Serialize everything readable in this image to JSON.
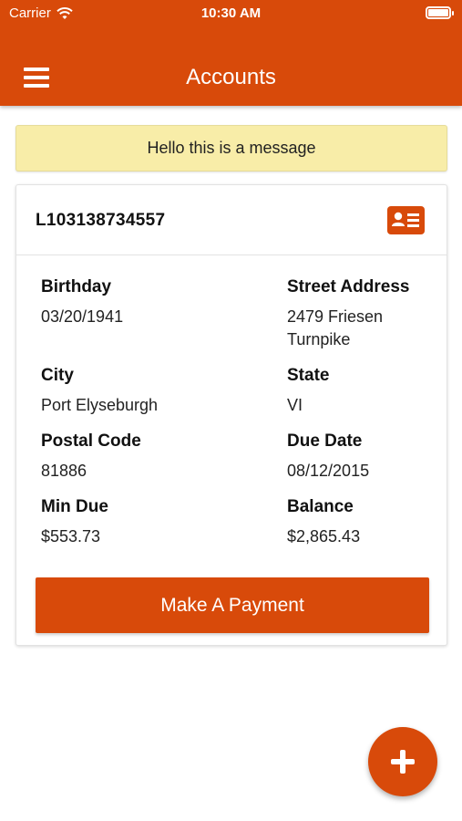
{
  "status_bar": {
    "carrier": "Carrier",
    "time": "10:30 AM"
  },
  "header": {
    "title": "Accounts",
    "menu_icon": "hamburger-menu-icon"
  },
  "banner": {
    "message": "Hello this is a message"
  },
  "account": {
    "number": "L103138734557",
    "id_card_icon": "id-card-icon",
    "fields": {
      "birthday": {
        "label": "Birthday",
        "value": "03/20/1941"
      },
      "street_address": {
        "label": "Street Address",
        "value": "2479 Friesen Turnpike"
      },
      "city": {
        "label": "City",
        "value": "Port Elyseburgh"
      },
      "state": {
        "label": "State",
        "value": "VI"
      },
      "postal_code": {
        "label": "Postal Code",
        "value": "81886"
      },
      "due_date": {
        "label": "Due Date",
        "value": "08/12/2015"
      },
      "min_due": {
        "label": "Min Due",
        "value": "$553.73"
      },
      "balance": {
        "label": "Balance",
        "value": "$2,865.43"
      }
    },
    "pay_button_label": "Make A Payment"
  },
  "fab": {
    "icon": "plus-icon"
  },
  "colors": {
    "primary": "#d84a0a",
    "banner_bg": "#f8eda8",
    "card_bg": "#ffffff"
  }
}
